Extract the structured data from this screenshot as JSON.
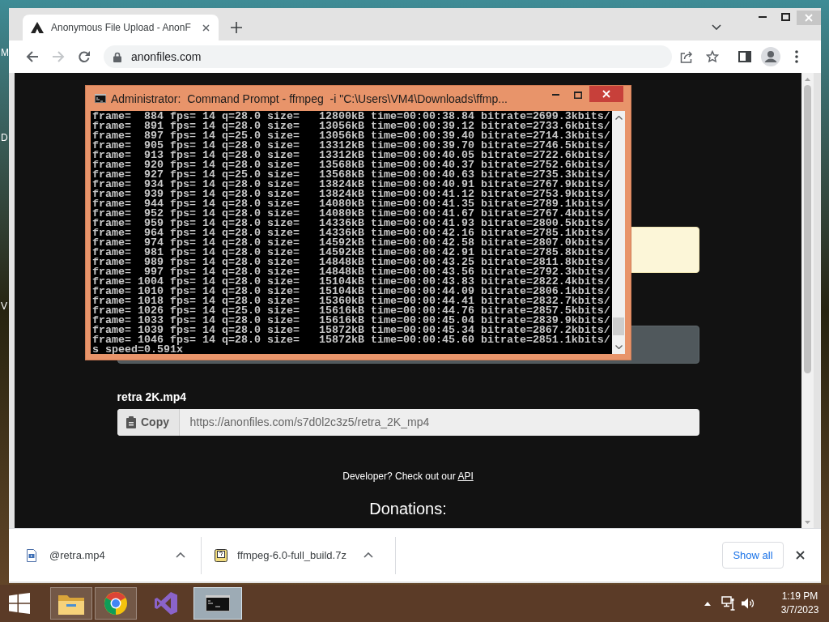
{
  "desktop_icon_labels": [
    "M",
    "D",
    "V"
  ],
  "browser": {
    "tabs": [
      {
        "title": "Anonymous File Upload - AnonF",
        "selected": true
      }
    ],
    "navigation": {
      "back_disabled": false,
      "forward_disabled": true
    },
    "address": "anonfiles.com",
    "page": {
      "file_name": "retra 2K.mp4",
      "copy_label": "Copy",
      "file_url": "https://anonfiles.com/s7d0l2c3z5/retra_2K_mp4",
      "developer_text": "Developer? Check out our",
      "api_link": "API",
      "donations_heading": "Donations:"
    },
    "downloads": [
      {
        "kind": "video",
        "name": "@retra.mp4"
      },
      {
        "kind": "archive",
        "name": "ffmpeg-6.0-full_build.7z"
      }
    ],
    "show_all_label": "Show all"
  },
  "console_window": {
    "title": "Administrator:  Command Prompt - ffmpeg  -i \"C:\\Users\\VM4\\Downloads\\ffmp...",
    "lines": [
      "frame=  884 fps= 14 q=28.0 size=   12800kB time=00:00:38.84 bitrate=2699.3kbits/",
      "frame=  891 fps= 14 q=28.0 size=   13056kB time=00:00:39.12 bitrate=2733.6kbits/",
      "frame=  897 fps= 14 q=25.0 size=   13056kB time=00:00:39.40 bitrate=2714.3kbits/",
      "frame=  905 fps= 14 q=28.0 size=   13312kB time=00:00:39.70 bitrate=2746.5kbits/",
      "frame=  913 fps= 14 q=28.0 size=   13312kB time=00:00:40.05 bitrate=2722.6kbits/",
      "frame=  920 fps= 14 q=28.0 size=   13568kB time=00:00:40.37 bitrate=2752.6kbits/",
      "frame=  927 fps= 14 q=25.0 size=   13568kB time=00:00:40.63 bitrate=2735.3kbits/",
      "frame=  934 fps= 14 q=28.0 size=   13824kB time=00:00:40.91 bitrate=2767.9kbits/",
      "frame=  939 fps= 14 q=28.0 size=   13824kB time=00:00:41.12 bitrate=2753.9kbits/",
      "frame=  944 fps= 14 q=28.0 size=   14080kB time=00:00:41.35 bitrate=2789.1kbits/",
      "frame=  952 fps= 14 q=28.0 size=   14080kB time=00:00:41.67 bitrate=2767.4kbits/",
      "frame=  959 fps= 14 q=28.0 size=   14336kB time=00:00:41.93 bitrate=2800.5kbits/",
      "frame=  964 fps= 14 q=28.0 size=   14336kB time=00:00:42.16 bitrate=2785.1kbits/",
      "frame=  974 fps= 14 q=28.0 size=   14592kB time=00:00:42.58 bitrate=2807.0kbits/",
      "frame=  981 fps= 14 q=28.0 size=   14592kB time=00:00:42.91 bitrate=2785.8kbits/",
      "frame=  989 fps= 14 q=28.0 size=   14848kB time=00:00:43.25 bitrate=2811.8kbits/",
      "frame=  997 fps= 14 q=28.0 size=   14848kB time=00:00:43.56 bitrate=2792.3kbits/",
      "frame= 1004 fps= 14 q=28.0 size=   15104kB time=00:00:43.83 bitrate=2822.4kbits/",
      "frame= 1010 fps= 14 q=28.0 size=   15104kB time=00:00:44.09 bitrate=2806.1kbits/",
      "frame= 1018 fps= 14 q=28.0 size=   15360kB time=00:00:44.41 bitrate=2832.7kbits/",
      "frame= 1026 fps= 14 q=25.0 size=   15616kB time=00:00:44.76 bitrate=2857.5kbits/",
      "frame= 1033 fps= 14 q=28.0 size=   15616kB time=00:00:45.04 bitrate=2839.9kbits/",
      "frame= 1039 fps= 14 q=28.0 size=   15872kB time=00:00:45.34 bitrate=2867.2kbits/",
      "frame= 1046 fps= 14 q=28.0 size=   15872kB time=00:00:45.60 bitrate=2851.1kbits/",
      "s speed=0.591x"
    ]
  },
  "taskbar": {
    "apps": [
      {
        "kind": "folder",
        "running": true,
        "selected": false
      },
      {
        "kind": "browser",
        "running": true,
        "selected": false
      },
      {
        "kind": "ide",
        "running": false,
        "selected": false
      },
      {
        "kind": "console",
        "running": true,
        "selected": true
      }
    ],
    "time": "1:19 PM",
    "date": "3/7/2023"
  }
}
